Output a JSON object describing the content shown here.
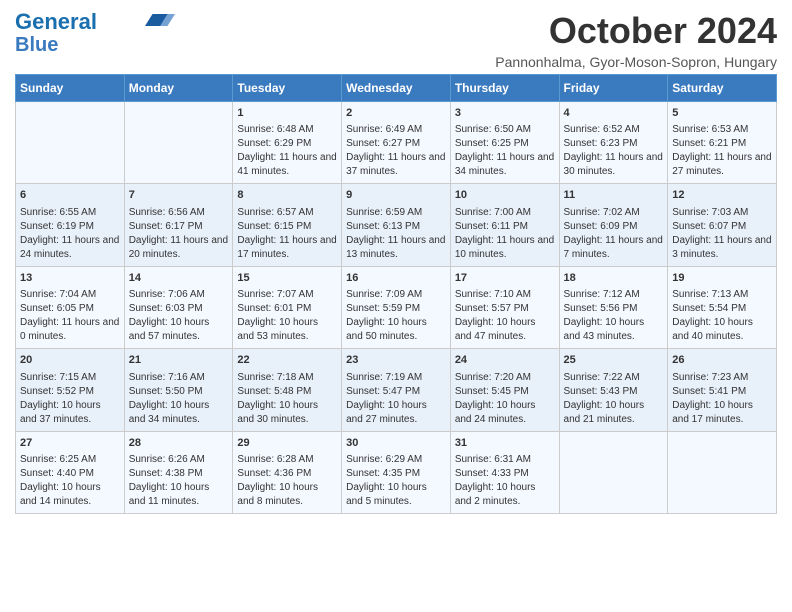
{
  "header": {
    "logo_line1": "General",
    "logo_line2": "Blue",
    "month_title": "October 2024",
    "subtitle": "Pannonhalma, Gyor-Moson-Sopron, Hungary"
  },
  "days_of_week": [
    "Sunday",
    "Monday",
    "Tuesday",
    "Wednesday",
    "Thursday",
    "Friday",
    "Saturday"
  ],
  "weeks": [
    [
      {
        "day": "",
        "info": ""
      },
      {
        "day": "",
        "info": ""
      },
      {
        "day": "1",
        "info": "Sunrise: 6:48 AM\nSunset: 6:29 PM\nDaylight: 11 hours and 41 minutes."
      },
      {
        "day": "2",
        "info": "Sunrise: 6:49 AM\nSunset: 6:27 PM\nDaylight: 11 hours and 37 minutes."
      },
      {
        "day": "3",
        "info": "Sunrise: 6:50 AM\nSunset: 6:25 PM\nDaylight: 11 hours and 34 minutes."
      },
      {
        "day": "4",
        "info": "Sunrise: 6:52 AM\nSunset: 6:23 PM\nDaylight: 11 hours and 30 minutes."
      },
      {
        "day": "5",
        "info": "Sunrise: 6:53 AM\nSunset: 6:21 PM\nDaylight: 11 hours and 27 minutes."
      }
    ],
    [
      {
        "day": "6",
        "info": "Sunrise: 6:55 AM\nSunset: 6:19 PM\nDaylight: 11 hours and 24 minutes."
      },
      {
        "day": "7",
        "info": "Sunrise: 6:56 AM\nSunset: 6:17 PM\nDaylight: 11 hours and 20 minutes."
      },
      {
        "day": "8",
        "info": "Sunrise: 6:57 AM\nSunset: 6:15 PM\nDaylight: 11 hours and 17 minutes."
      },
      {
        "day": "9",
        "info": "Sunrise: 6:59 AM\nSunset: 6:13 PM\nDaylight: 11 hours and 13 minutes."
      },
      {
        "day": "10",
        "info": "Sunrise: 7:00 AM\nSunset: 6:11 PM\nDaylight: 11 hours and 10 minutes."
      },
      {
        "day": "11",
        "info": "Sunrise: 7:02 AM\nSunset: 6:09 PM\nDaylight: 11 hours and 7 minutes."
      },
      {
        "day": "12",
        "info": "Sunrise: 7:03 AM\nSunset: 6:07 PM\nDaylight: 11 hours and 3 minutes."
      }
    ],
    [
      {
        "day": "13",
        "info": "Sunrise: 7:04 AM\nSunset: 6:05 PM\nDaylight: 11 hours and 0 minutes."
      },
      {
        "day": "14",
        "info": "Sunrise: 7:06 AM\nSunset: 6:03 PM\nDaylight: 10 hours and 57 minutes."
      },
      {
        "day": "15",
        "info": "Sunrise: 7:07 AM\nSunset: 6:01 PM\nDaylight: 10 hours and 53 minutes."
      },
      {
        "day": "16",
        "info": "Sunrise: 7:09 AM\nSunset: 5:59 PM\nDaylight: 10 hours and 50 minutes."
      },
      {
        "day": "17",
        "info": "Sunrise: 7:10 AM\nSunset: 5:57 PM\nDaylight: 10 hours and 47 minutes."
      },
      {
        "day": "18",
        "info": "Sunrise: 7:12 AM\nSunset: 5:56 PM\nDaylight: 10 hours and 43 minutes."
      },
      {
        "day": "19",
        "info": "Sunrise: 7:13 AM\nSunset: 5:54 PM\nDaylight: 10 hours and 40 minutes."
      }
    ],
    [
      {
        "day": "20",
        "info": "Sunrise: 7:15 AM\nSunset: 5:52 PM\nDaylight: 10 hours and 37 minutes."
      },
      {
        "day": "21",
        "info": "Sunrise: 7:16 AM\nSunset: 5:50 PM\nDaylight: 10 hours and 34 minutes."
      },
      {
        "day": "22",
        "info": "Sunrise: 7:18 AM\nSunset: 5:48 PM\nDaylight: 10 hours and 30 minutes."
      },
      {
        "day": "23",
        "info": "Sunrise: 7:19 AM\nSunset: 5:47 PM\nDaylight: 10 hours and 27 minutes."
      },
      {
        "day": "24",
        "info": "Sunrise: 7:20 AM\nSunset: 5:45 PM\nDaylight: 10 hours and 24 minutes."
      },
      {
        "day": "25",
        "info": "Sunrise: 7:22 AM\nSunset: 5:43 PM\nDaylight: 10 hours and 21 minutes."
      },
      {
        "day": "26",
        "info": "Sunrise: 7:23 AM\nSunset: 5:41 PM\nDaylight: 10 hours and 17 minutes."
      }
    ],
    [
      {
        "day": "27",
        "info": "Sunrise: 6:25 AM\nSunset: 4:40 PM\nDaylight: 10 hours and 14 minutes."
      },
      {
        "day": "28",
        "info": "Sunrise: 6:26 AM\nSunset: 4:38 PM\nDaylight: 10 hours and 11 minutes."
      },
      {
        "day": "29",
        "info": "Sunrise: 6:28 AM\nSunset: 4:36 PM\nDaylight: 10 hours and 8 minutes."
      },
      {
        "day": "30",
        "info": "Sunrise: 6:29 AM\nSunset: 4:35 PM\nDaylight: 10 hours and 5 minutes."
      },
      {
        "day": "31",
        "info": "Sunrise: 6:31 AM\nSunset: 4:33 PM\nDaylight: 10 hours and 2 minutes."
      },
      {
        "day": "",
        "info": ""
      },
      {
        "day": "",
        "info": ""
      }
    ]
  ]
}
